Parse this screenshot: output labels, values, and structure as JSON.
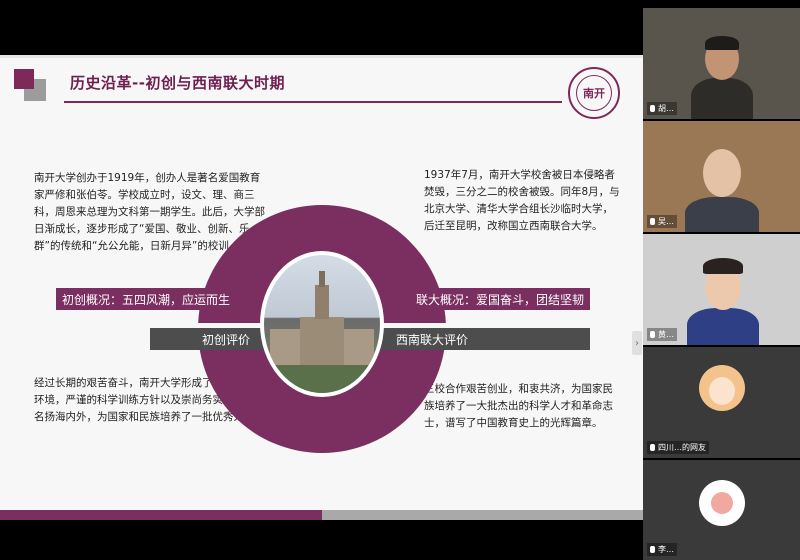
{
  "slide": {
    "title": "历史沿革--初创与西南联大时期",
    "logo_text": "南开",
    "block1": "南开大学创办于1919年，创办人是著名爱国教育家严修和张伯苓。学校成立时，设文、理、商三科，周恩来总理为文科第一期学生。此后，大学部日渐成长，逐步形成了“爱国、敬业、创新、乐群”的传统和“允公允能，日新月异”的校训。",
    "block2": "1937年7月，南开大学校舍被日本侵略者焚毁，三分之二的校舍被毁。同年8月，与北京大学、清华大学合组长沙临时大学，后迁至昆明，改称国立西南联合大学。",
    "block3": "经过长期的艰苦奋斗，南开大学形成了优越的学术环境，严谨的科学训练方针以及崇尚务实的精神而名扬海内外，为国家和民族培养了一批优秀人才。",
    "block4": "三校合作艰苦创业，和衷共济，为国家民族培养了一大批杰出的科学人才和革命志士，谱写了中国教育史上的光辉篇章。",
    "band_top_left": "初创概况：五四风潮，应运而生",
    "band_top_right": "联大概况：爱国奋斗，团结坚韧",
    "band_bottom_left": "初创评价",
    "band_bottom_right": "西南联大评价",
    "nav_arrow": "›"
  },
  "progress": {
    "fraction": 0.5
  },
  "participants": [
    {
      "name": "胡…",
      "tone": "#5a554c"
    },
    {
      "name": "吴…",
      "tone": "#9b7855"
    },
    {
      "name": "黄…",
      "tone": "#cfcfcf"
    },
    {
      "name": "四川…的网友",
      "tone": "#3a3a3a"
    },
    {
      "name": "李…",
      "tone": "#3a3a3a"
    }
  ],
  "colors": {
    "accent": "#7a2f60",
    "dark": "#4d4d4d"
  }
}
